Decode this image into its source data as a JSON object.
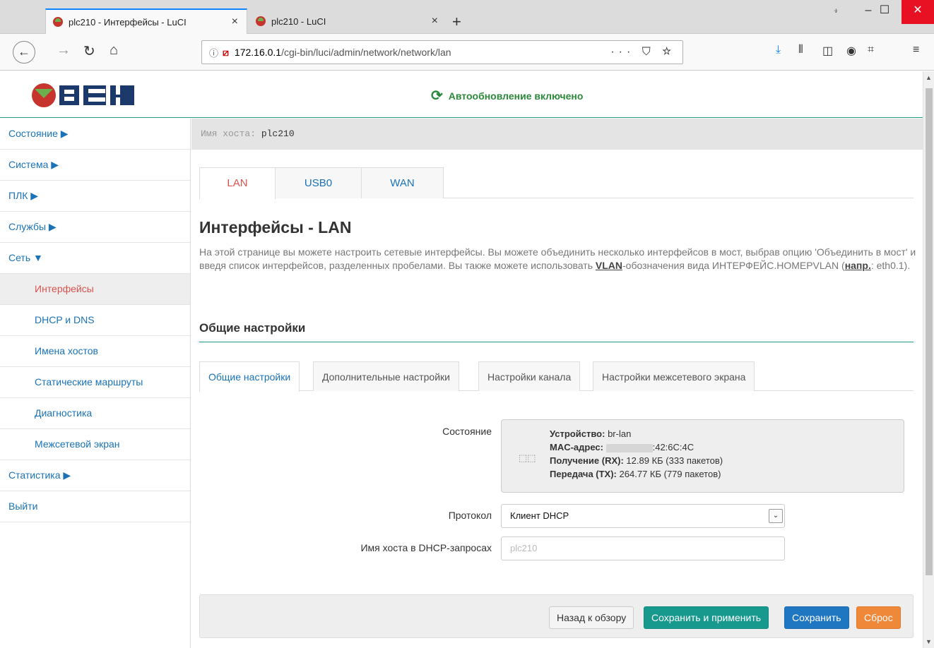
{
  "browser": {
    "tabs": [
      {
        "title": "plc210 - Интерфейсы - LuCI"
      },
      {
        "title": "plc210 - LuCI"
      }
    ],
    "new_tab": "+",
    "close_glyph": "×",
    "url_host": "172.16.0.1",
    "url_path": "/cgi-bin/luci/admin/network/network/lan",
    "url_actions": "··· ⛉ ☆"
  },
  "header": {
    "autorefresh": "Автообновление включено"
  },
  "sidebar": {
    "items": [
      {
        "label": "Состояние ▶"
      },
      {
        "label": "Система ▶"
      },
      {
        "label": "ПЛК ▶"
      },
      {
        "label": "Службы ▶"
      },
      {
        "label": "Сеть ▼"
      },
      {
        "label": "Интерфейсы"
      },
      {
        "label": "DHCP и DNS"
      },
      {
        "label": "Имена хостов"
      },
      {
        "label": "Статические маршруты"
      },
      {
        "label": "Диагностика"
      },
      {
        "label": "Межсетевой экран"
      },
      {
        "label": "Статистика ▶"
      },
      {
        "label": "Выйти"
      }
    ]
  },
  "hostbar": {
    "label": "Имя хоста: ",
    "value": "plc210"
  },
  "main_tabs": [
    {
      "label": "LAN"
    },
    {
      "label": "USB0"
    },
    {
      "label": "WAN"
    }
  ],
  "page": {
    "title": "Интерфейсы - LAN",
    "desc_part1": "На этой странице вы можете настроить сетевые интерфейсы. Вы можете объединить несколько интерфейсов в мост, выбрав опцию 'Объединить в мост' и введя список интерфейсов, разделенных пробелами. Вы также можете использовать ",
    "desc_vlan": "VLAN",
    "desc_part2": "-обозначения вида ИНТЕРФЕЙС.НОМЕРVLAN (",
    "desc_eg": "напр.",
    "desc_part3": ": eth0.1).",
    "section_title": "Общие настройки"
  },
  "sub_tabs": [
    {
      "label": "Общие настройки"
    },
    {
      "label": "Дополнительные настройки"
    },
    {
      "label": "Настройки канала"
    },
    {
      "label": "Настройки межсетевого экрана"
    }
  ],
  "form": {
    "status_label": "Состояние",
    "status": {
      "device_label": "Устройство:",
      "device_value": "br-lan",
      "mac_label": "MAC-адрес:",
      "mac_value": ":42:6C:4C",
      "rx_label": "Получение (RX):",
      "rx_value": "12.89 КБ (333 пакетов)",
      "tx_label": "Передача (TX):",
      "tx_value": "264.77 КБ (779 пакетов)"
    },
    "protocol_label": "Протокол",
    "protocol_value": "Клиент DHCP",
    "hostname_label": "Имя хоста в DHCP-запросах",
    "hostname_placeholder": "plc210"
  },
  "actions": {
    "back": "Назад к обзору",
    "save_apply": "Сохранить и применить",
    "save": "Сохранить",
    "reset": "Сброс"
  },
  "colors": {
    "accent_teal": "#1a9b8e",
    "link_blue": "#1a73b8",
    "active_red": "#d9534f",
    "refresh_green": "#2a8a3a"
  }
}
